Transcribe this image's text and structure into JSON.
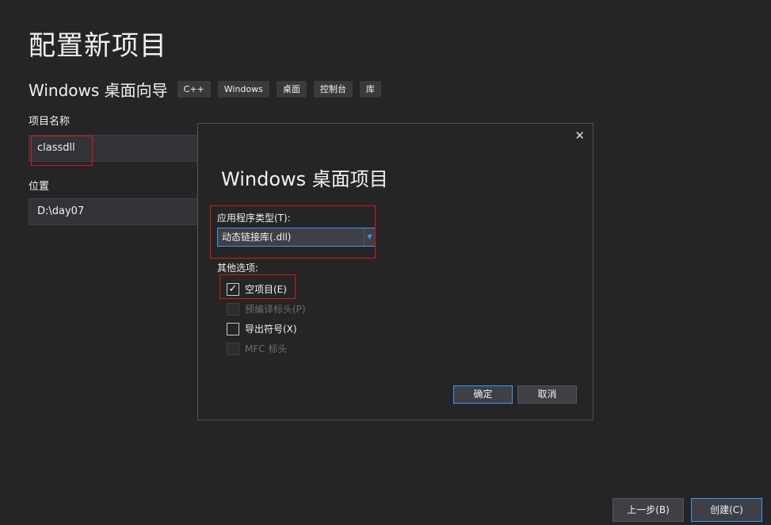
{
  "page": {
    "title": "配置新项目",
    "template_name": "Windows 桌面向导",
    "tags": [
      "C++",
      "Windows",
      "桌面",
      "控制台",
      "库"
    ]
  },
  "form": {
    "project_name_label": "项目名称",
    "project_name_value": "classdll",
    "location_label": "位置",
    "location_value": "D:\\day07"
  },
  "dialog": {
    "close_glyph": "✕",
    "title": "Windows 桌面项目",
    "app_type_label": "应用程序类型(T):",
    "app_type_value": "动态链接库(.dll)",
    "other_options_label": "其他选项:",
    "options": [
      {
        "label": "空项目(E)",
        "checked": true,
        "enabled": true
      },
      {
        "label": "预编译标头(P)",
        "checked": false,
        "enabled": false
      },
      {
        "label": "导出符号(X)",
        "checked": false,
        "enabled": true
      },
      {
        "label": "MFC 标头",
        "checked": false,
        "enabled": false
      }
    ],
    "ok_label": "确定",
    "cancel_label": "取消"
  },
  "footer": {
    "back_label": "上一步(B)",
    "create_label": "创建(C)"
  },
  "colors": {
    "background": "#252526",
    "accent": "#3399ff",
    "highlight": "#e01414"
  }
}
